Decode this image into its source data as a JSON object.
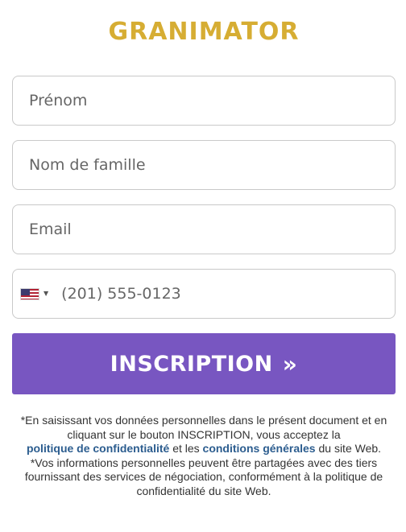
{
  "brand": {
    "name": "GRANIMATOR",
    "color": "#d6ad33"
  },
  "form": {
    "first_name_placeholder": "Prénom",
    "last_name_placeholder": "Nom de famille",
    "email_placeholder": "Email",
    "phone": {
      "country_flag": "us-flag-icon",
      "placeholder": "(201) 555-0123"
    },
    "submit_label": "INSCRIPTION",
    "submit_chevron": "»",
    "submit_color": "#7856c1"
  },
  "disclaimer": {
    "p1_start": "*En saisissant vos données personnelles dans le présent document et en cliquant sur le bouton INSCRIPTION, vous acceptez la",
    "privacy_link": "politique de confidentialité",
    "p1_middle": "et les",
    "terms_link": "conditions générales",
    "p1_end": "du site Web.",
    "p2": "*Vos informations personnelles peuvent être partagées avec des tiers fournissant des services de négociation, conformément à la politique de confidentialité du site Web.",
    "link_color": "#2c5d8f"
  }
}
